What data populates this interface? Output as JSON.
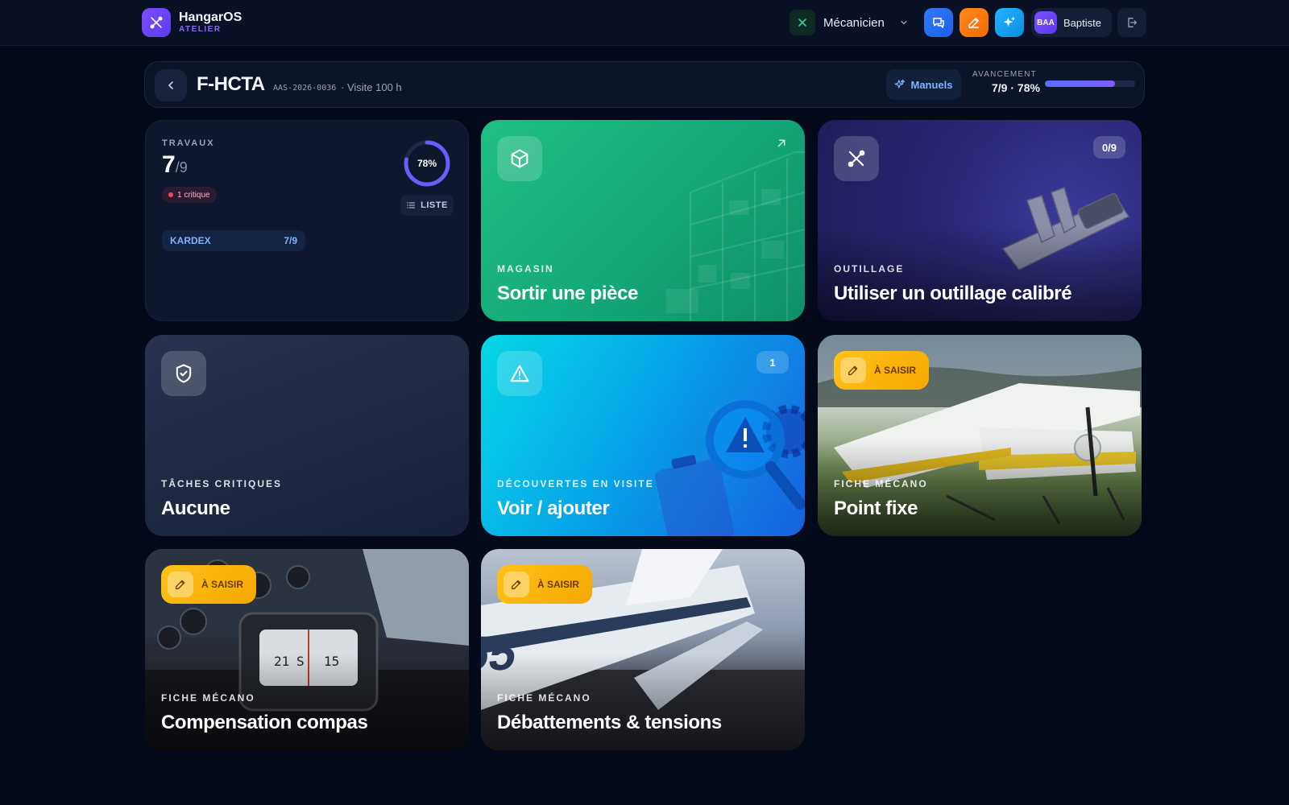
{
  "app": {
    "name": "HangarOS",
    "subtitle": "ATELIER"
  },
  "topbar": {
    "role": "Mécanicien",
    "user": {
      "initials": "BAA",
      "name": "Baptiste"
    }
  },
  "header": {
    "registration": "F-HCTA",
    "ref": "AAS-2026-0036",
    "visit": "· Visite 100 h",
    "manuals_label": "Manuels",
    "progress_label": "AVANCEMENT",
    "progress_text": "7/9 · 78%",
    "progress_value": 0.78
  },
  "colors": {
    "background": "#050a1a",
    "accent": "#7c4dff",
    "magasin": "#1fbf83",
    "outillage": "#2b2878",
    "decouvertes": "#06a6e8",
    "saisir": "#ffc21a"
  },
  "cards": {
    "travaux": {
      "label": "TRAVAUX",
      "value": "7",
      "total": "/9",
      "critical": "1 critique",
      "percent": "78%",
      "percent_value": 0.78,
      "list_label": "LISTE",
      "kardex_label": "KARDEX",
      "kardex_value": "7/9"
    },
    "magasin": {
      "category": "MAGASIN",
      "title": "Sortir une pièce",
      "icon": "box-icon"
    },
    "outillage": {
      "category": "OUTILLAGE",
      "title": "Utiliser un outillage calibré",
      "badge": "0/9",
      "icon": "tools-icon"
    },
    "critiques": {
      "category": "TÂCHES CRITIQUES",
      "title": "Aucune",
      "icon": "shield-check-icon"
    },
    "decouvertes": {
      "category": "DÉCOUVERTES EN VISITE",
      "title": "Voir / ajouter",
      "badge": "1",
      "icon": "warning-icon"
    },
    "point_fixe": {
      "pill": "À SAISIR",
      "category": "FICHE MÉCANO",
      "title": "Point fixe"
    },
    "compas": {
      "pill": "À SAISIR",
      "category": "FICHE MÉCANO",
      "title": "Compensation compas"
    },
    "debattements": {
      "pill": "À SAISIR",
      "category": "FICHE MÉCANO",
      "title": "Débattements & tensions"
    }
  }
}
